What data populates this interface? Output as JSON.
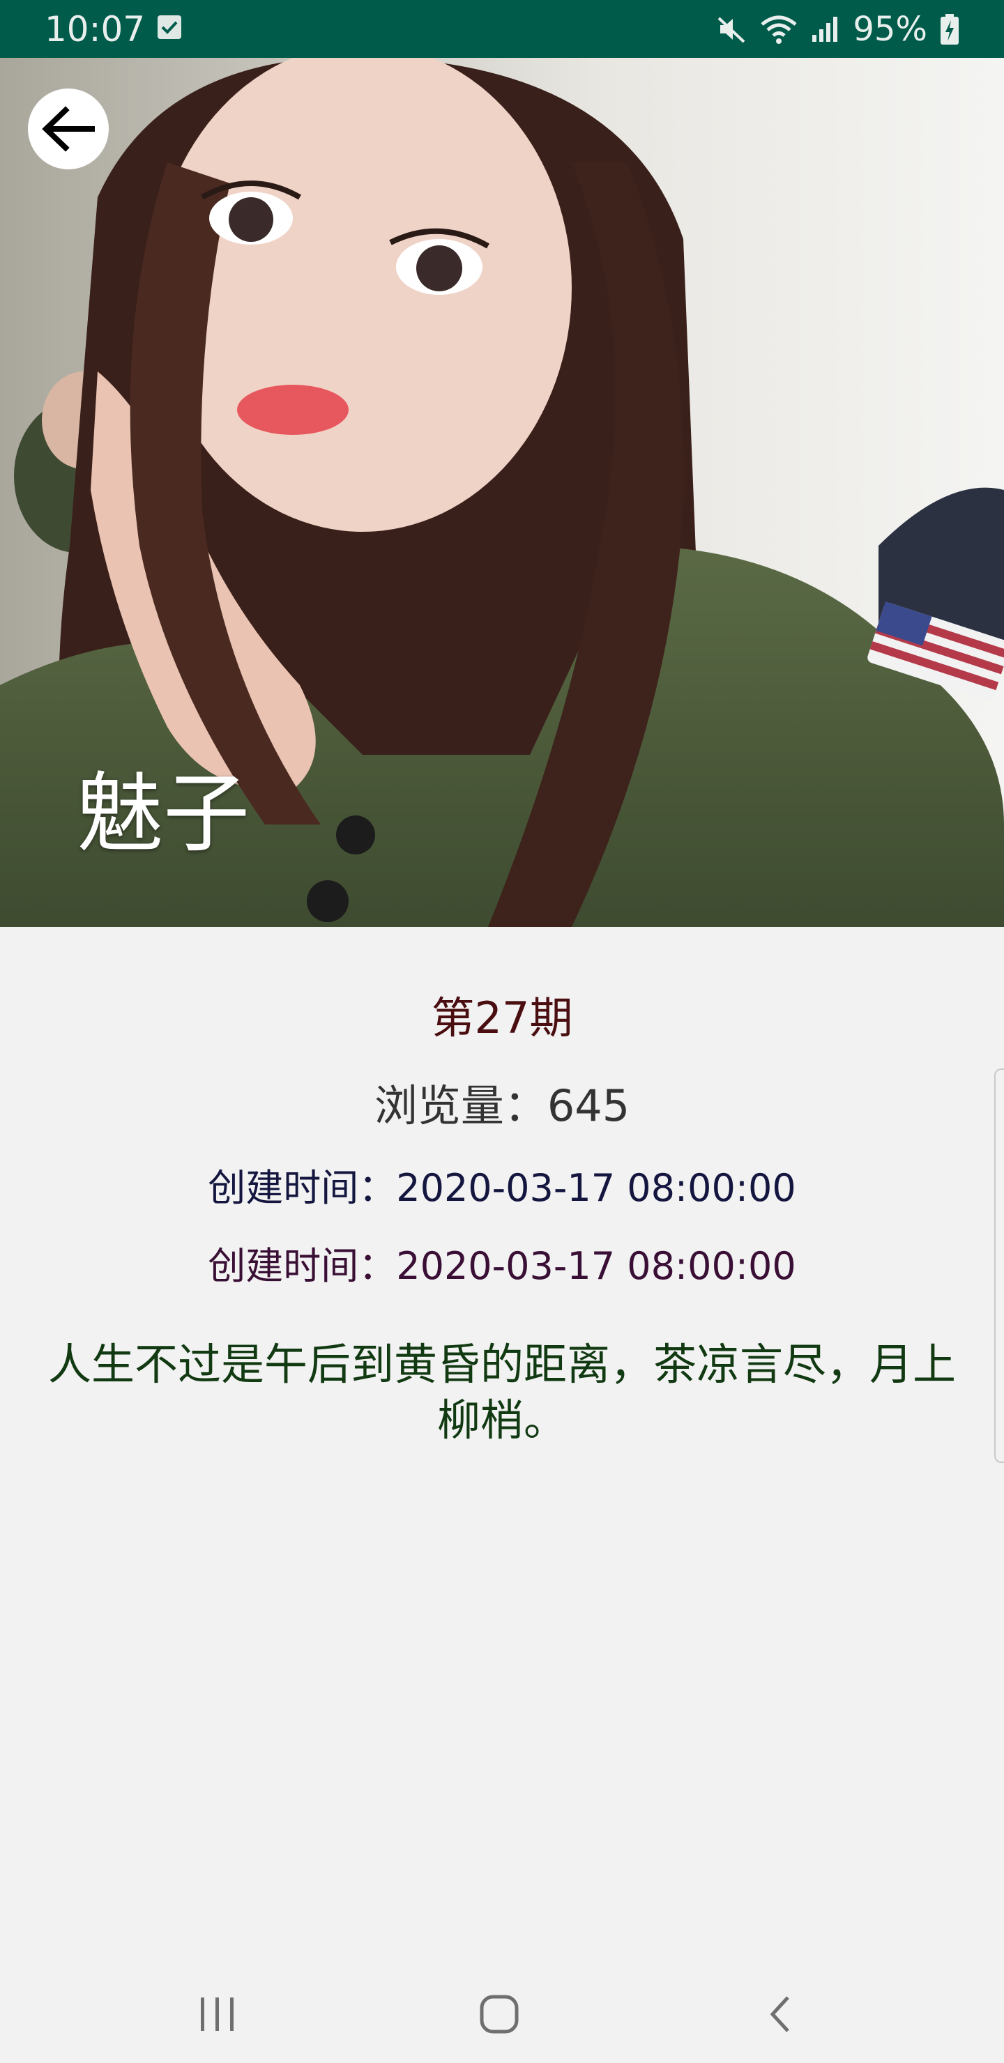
{
  "status_bar": {
    "time": "10:07",
    "battery_percent": "95%",
    "icons": [
      "check-notification-icon",
      "mute-icon",
      "wifi-icon",
      "signal-icon",
      "battery-charging-icon"
    ]
  },
  "hero": {
    "name": "魅子",
    "back_icon": "arrow-left-icon"
  },
  "detail": {
    "issue": "第27期",
    "views": "浏览量：645",
    "created_1": "创建时间：2020-03-17 08:00:00",
    "created_2": "创建时间：2020-03-17 08:00:00",
    "quote": "人生不过是午后到黄昏的距离，茶凉言尽，月上柳梢。"
  },
  "nav_bar": {
    "icons": [
      "recents-icon",
      "home-icon",
      "back-icon"
    ]
  },
  "colors": {
    "status_bar": "#005b4a",
    "background": "#f2f2f2",
    "issue_text": "#4a0d10",
    "quote_text": "#123a12"
  }
}
